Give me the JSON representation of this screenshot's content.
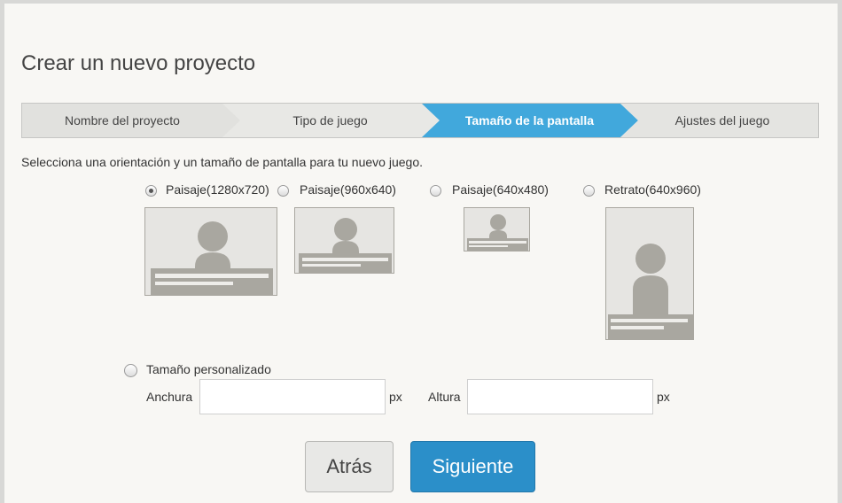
{
  "dialog": {
    "title": "Crear un nuevo proyecto",
    "description": "Selecciona una orientación y un tamaño de pantalla para tu nuevo juego."
  },
  "steps": [
    {
      "label": "Nombre del proyecto",
      "active": false
    },
    {
      "label": "Tipo de juego",
      "active": false
    },
    {
      "label": "Tamaño de la pantalla",
      "active": true
    },
    {
      "label": "Ajustes del juego",
      "active": false
    }
  ],
  "orientations": [
    {
      "label": "Paisaje(1280x720)",
      "selected": true
    },
    {
      "label": "Paisaje(960x640)",
      "selected": false
    },
    {
      "label": "Paisaje(640x480)",
      "selected": false
    },
    {
      "label": "Retrato(640x960)",
      "selected": false
    }
  ],
  "custom": {
    "label": "Tamaño personalizado",
    "selected": false,
    "width_label": "Anchura",
    "width_value": "",
    "height_label": "Altura",
    "height_value": "",
    "unit": "px"
  },
  "buttons": {
    "back": "Atrás",
    "next": "Siguiente"
  },
  "colors": {
    "accent": "#41a8dc",
    "primary_button": "#2b8fc9"
  }
}
